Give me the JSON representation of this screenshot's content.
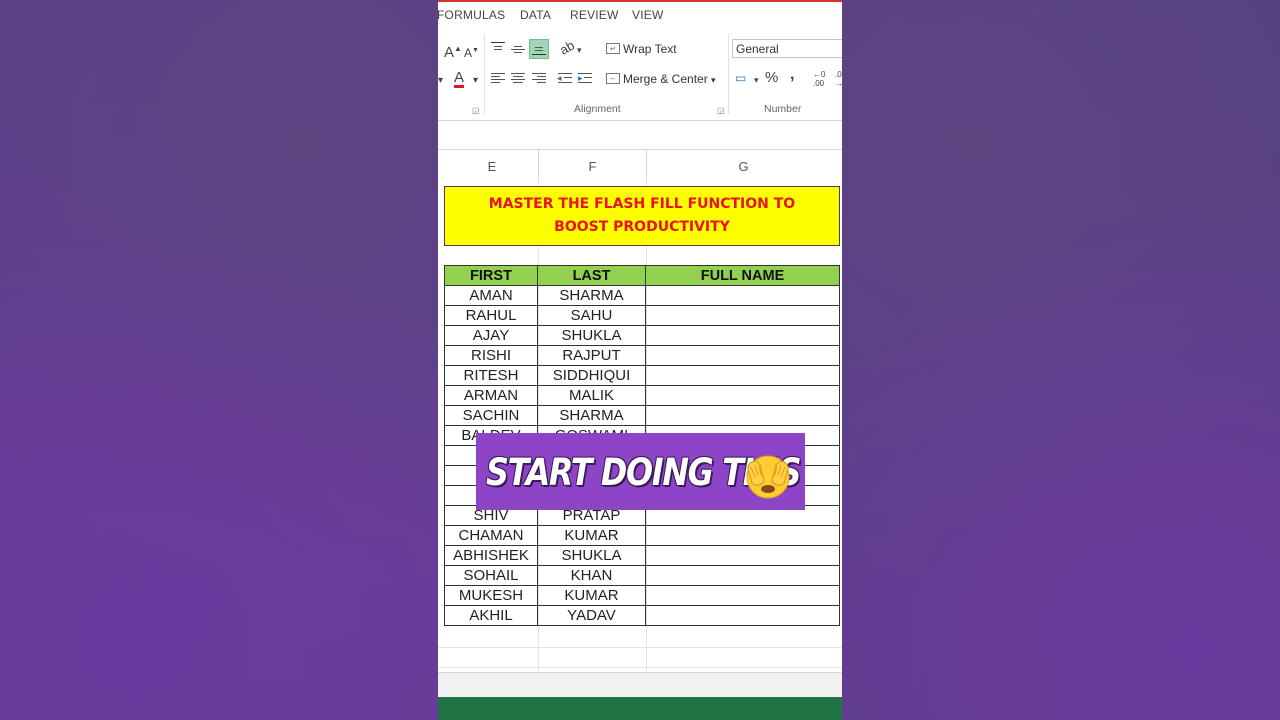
{
  "menu": {
    "items": [
      "FORMULAS",
      "DATA",
      "REVIEW",
      "VIEW"
    ]
  },
  "ribbon": {
    "font_glyphs": {
      "grow": "A",
      "shrink": "A",
      "font_color": "A"
    },
    "alignment": {
      "wrap_text": "Wrap Text",
      "merge_center": "Merge & Center",
      "label": "Alignment"
    },
    "number": {
      "format": "General",
      "percent": "%",
      "comma": ",",
      "label": "Number"
    }
  },
  "columns": [
    "E",
    "F",
    "G"
  ],
  "sheet": {
    "title_line1": "MASTER THE FLASH FILL FUNCTION TO",
    "title_line2": "BOOST PRODUCTIVITY",
    "headers": {
      "first": "FIRST",
      "last": "LAST",
      "full": "FULL NAME"
    },
    "rows": [
      {
        "first": "AMAN",
        "last": "SHARMA"
      },
      {
        "first": "RAHUL",
        "last": "SAHU"
      },
      {
        "first": "AJAY",
        "last": "SHUKLA"
      },
      {
        "first": "RISHI",
        "last": "RAJPUT"
      },
      {
        "first": "RITESH",
        "last": "SIDDHIQUI"
      },
      {
        "first": "ARMAN",
        "last": "MALIK"
      },
      {
        "first": "SACHIN",
        "last": "SHARMA"
      },
      {
        "first": "BALDEV",
        "last": "GOSWAMI"
      },
      {
        "first": "",
        "last": ""
      },
      {
        "first": "",
        "last": ""
      },
      {
        "first": "",
        "last": ""
      },
      {
        "first": "SHIV",
        "last": "PRATAP"
      },
      {
        "first": "CHAMAN",
        "last": "KUMAR"
      },
      {
        "first": "ABHISHEK",
        "last": "SHUKLA"
      },
      {
        "first": "SOHAIL",
        "last": "KHAN"
      },
      {
        "first": "MUKESH",
        "last": "KUMAR"
      },
      {
        "first": "AKHIL",
        "last": "YADAV"
      }
    ]
  },
  "overlay": {
    "text": "START DOING THIS",
    "emoji": "face-with-hand-over-eye-icon"
  },
  "colors": {
    "background": "#5f3d8e",
    "title_fill": "#ffff00",
    "title_text": "#e8131b",
    "header_fill": "#92d050",
    "banner": "#8e44c6",
    "status_green": "#217346"
  }
}
